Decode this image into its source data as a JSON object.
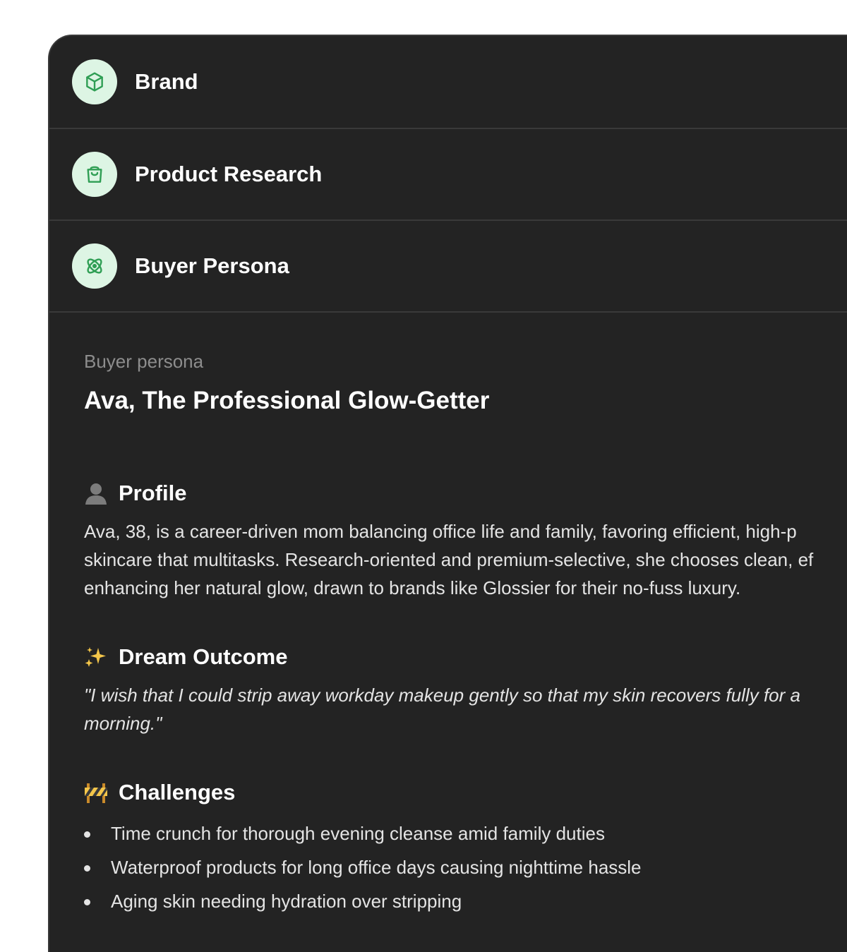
{
  "nav": {
    "items": [
      {
        "label": "Brand",
        "icon": "cube-icon"
      },
      {
        "label": "Product Research",
        "icon": "shopping-bag-icon"
      },
      {
        "label": "Buyer Persona",
        "icon": "persona-atom-icon"
      }
    ]
  },
  "persona": {
    "eyebrow": "Buyer persona",
    "title": "Ava, The Professional Glow-Getter",
    "profile": {
      "heading": "Profile",
      "icon": "bust-silhouette-icon",
      "lines": [
        "Ava, 38, is a career-driven mom balancing office life and family, favoring efficient, high-p",
        "skincare that multitasks. Research-oriented and premium-selective, she chooses clean, ef",
        "enhancing her natural glow, drawn to brands like Glossier for their no-fuss luxury."
      ]
    },
    "dream_outcome": {
      "heading": "Dream Outcome",
      "icon": "sparkles-icon",
      "lines": [
        "\"I wish that I could strip away workday makeup gently so that my skin recovers fully for a",
        "morning.\""
      ]
    },
    "challenges": {
      "heading": "Challenges",
      "icon": "construction-barrier-icon",
      "items": [
        "Time crunch for thorough evening cleanse amid family duties",
        "Waterproof products for long office days causing nighttime hassle",
        "Aging skin needing hydration over stripping"
      ]
    }
  },
  "colors": {
    "panel_bg": "#232323",
    "icon_bg": "#ddf5e4",
    "icon_stroke": "#2f9e54",
    "divider": "#3a3a3a"
  }
}
